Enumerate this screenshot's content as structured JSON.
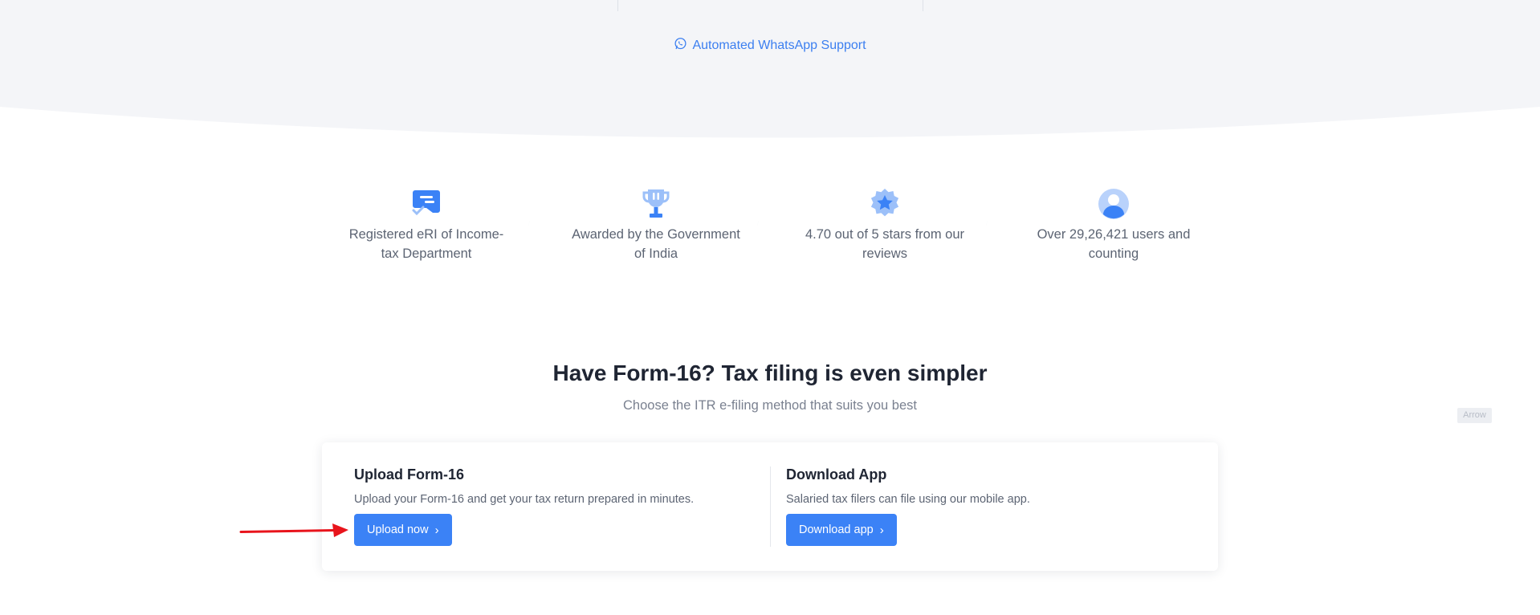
{
  "top": {
    "whatsapp_label": "Automated WhatsApp Support"
  },
  "features": [
    {
      "icon": "certificate-icon",
      "text": "Registered eRI of Income-tax Department"
    },
    {
      "icon": "trophy-icon",
      "text": "Awarded by the Government of India"
    },
    {
      "icon": "star-badge-icon",
      "text": "4.70 out of 5 stars from our reviews"
    },
    {
      "icon": "user-avatar-icon",
      "text": "Over 29,26,421 users and counting"
    }
  ],
  "section": {
    "title": "Have Form-16? Tax filing is even simpler",
    "subtitle": "Choose the ITR e-filing method that suits you best",
    "arrow_tag": "Arrow"
  },
  "options": {
    "upload": {
      "title": "Upload Form-16",
      "description": "Upload your Form-16 and get your tax return prepared in minutes.",
      "button": "Upload now"
    },
    "app": {
      "title": "Download App",
      "description": "Salaried tax filers can file using our mobile app.",
      "button": "Download app"
    }
  },
  "colors": {
    "accent": "#3b82f6",
    "link": "#3c7ff0",
    "band": "#f4f5f8",
    "annotation_arrow": "#e8141c"
  }
}
